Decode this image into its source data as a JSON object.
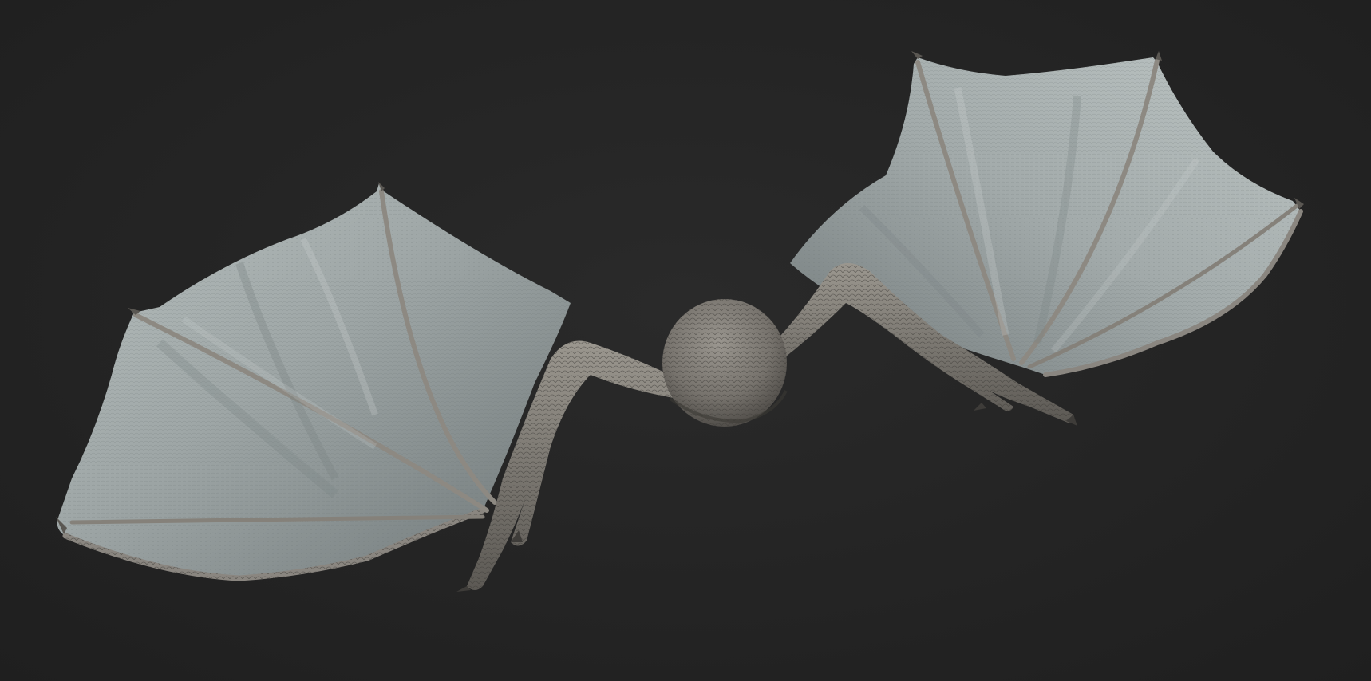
{
  "viewport": {
    "background_color": "#232323",
    "content": "dragon-sculpt-model",
    "material_colors": {
      "membrane": "#9aa3a3",
      "membrane_highlight": "#c9d0cf",
      "membrane_shadow": "#5e6566",
      "rim_tint": "#7fa7b8",
      "scales": "#8e8a84",
      "scales_dark": "#4d4a46"
    }
  }
}
